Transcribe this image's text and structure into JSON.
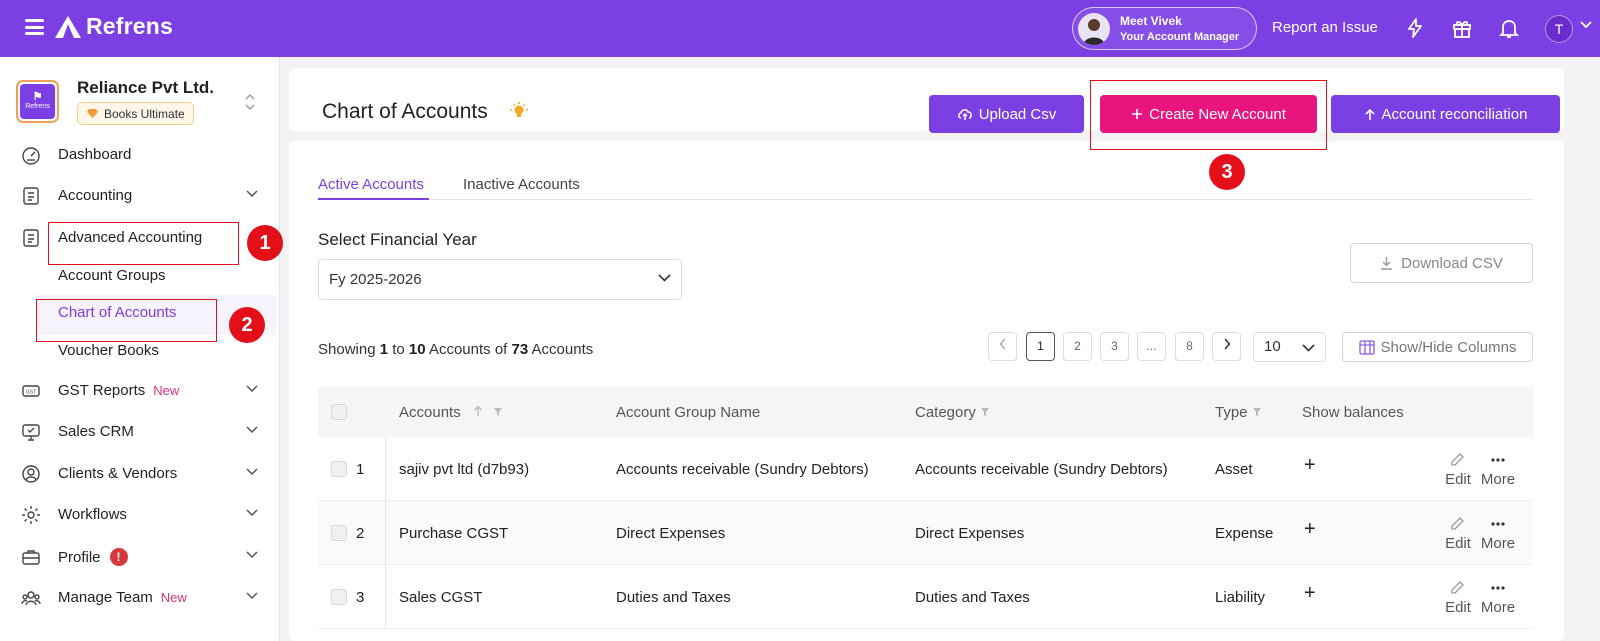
{
  "topbar": {
    "app_name": "Refrens",
    "manager_name": "Meet Vivek",
    "manager_role": "Your Account Manager",
    "report_issue": "Report an Issue",
    "user_initial": "T"
  },
  "sidebar": {
    "company_name": "Reliance Pvt Ltd.",
    "company_logo_text": "Refrens",
    "plan": "Books Ultimate",
    "items": [
      {
        "label": "Dashboard"
      },
      {
        "label": "Accounting"
      },
      {
        "label": "Advanced Accounting"
      },
      {
        "label": "GST Reports",
        "tag": "New"
      },
      {
        "label": "Sales CRM"
      },
      {
        "label": "Clients & Vendors"
      },
      {
        "label": "Workflows"
      },
      {
        "label": "Profile",
        "alert": "!"
      },
      {
        "label": "Manage Team",
        "tag": "New"
      }
    ],
    "sub_items": [
      {
        "label": "Account Groups"
      },
      {
        "label": "Chart of Accounts",
        "active": true
      },
      {
        "label": "Voucher Books"
      }
    ]
  },
  "annotations": [
    "1",
    "2",
    "3"
  ],
  "header": {
    "title": "Chart of Accounts",
    "upload_csv": "Upload Csv",
    "create_account": "Create New Account",
    "reconciliation": "Account reconciliation"
  },
  "tabs": {
    "active": "Active Accounts",
    "inactive": "Inactive Accounts"
  },
  "filters": {
    "fy_label": "Select Financial Year",
    "fy_value": "Fy 2025-2026",
    "download_csv": "Download CSV"
  },
  "showing": {
    "prefix": "Showing",
    "from": "1",
    "to_word": "to",
    "to": "10",
    "accounts_of": "Accounts of",
    "total": "73",
    "suffix": "Accounts"
  },
  "pagination": {
    "pages": [
      "1",
      "2",
      "3",
      "...",
      "8"
    ],
    "current": "1",
    "rows_per_page": "10",
    "show_hide_columns": "Show/Hide Columns"
  },
  "table": {
    "columns": [
      "Accounts",
      "Account Group Name",
      "Category",
      "Type",
      "Show balances"
    ],
    "rows": [
      {
        "no": "1",
        "account": "sajiv pvt ltd (d7b93)",
        "group": "Accounts receivable (Sundry Debtors)",
        "category": "Accounts receivable (Sundry Debtors)",
        "type": "Asset"
      },
      {
        "no": "2",
        "account": "Purchase CGST",
        "group": "Direct Expenses",
        "category": "Direct Expenses",
        "type": "Expense"
      },
      {
        "no": "3",
        "account": "Sales CGST",
        "group": "Duties and Taxes",
        "category": "Duties and Taxes",
        "type": "Liability"
      }
    ],
    "edit_label": "Edit",
    "more_label": "More",
    "plus_symbol": "+"
  },
  "colors": {
    "brand": "#7b3fe4",
    "accent_pink": "#e9147d",
    "annotation_red": "#e3101a"
  }
}
